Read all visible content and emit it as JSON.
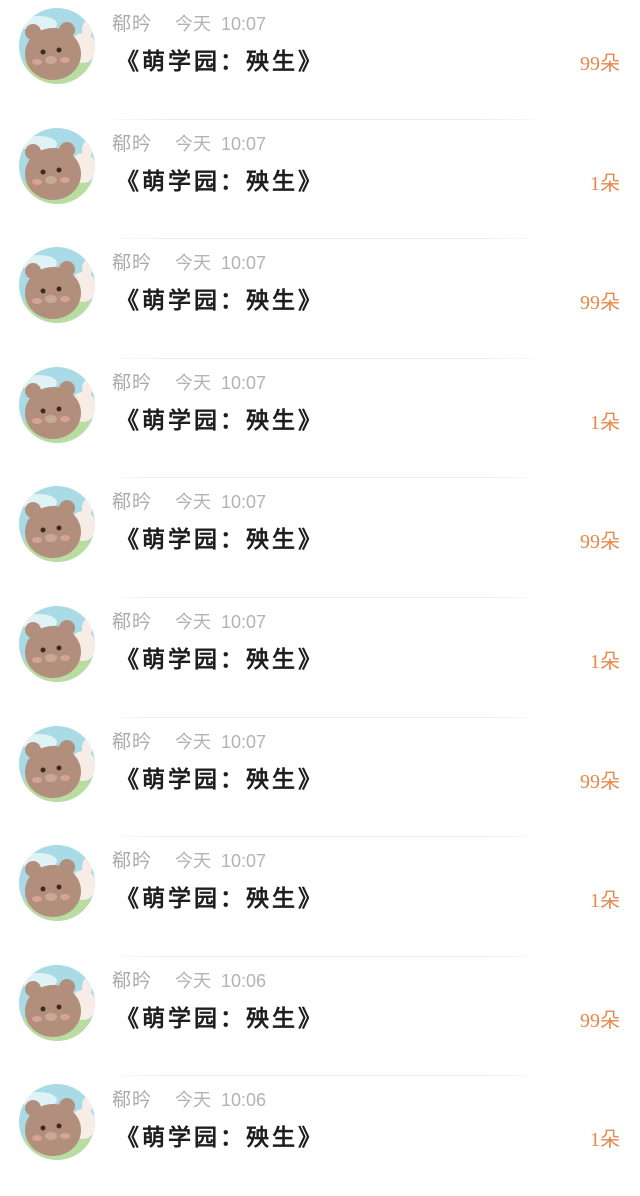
{
  "colors": {
    "sender_text": "#a9a9a9",
    "time_text": "#b3b3b3",
    "title_text": "#1e1e1e",
    "amount_text": "#e8884a",
    "avatar_bg_sky": "#a9dbe7",
    "avatar_bg_grass": "#b9dca1",
    "avatar_bear": "#b18f7c"
  },
  "messages": [
    {
      "sender": "郗昑",
      "day": "今天",
      "time": "10:07",
      "title": "《萌学园：殃生》",
      "amount": "99朵",
      "avatar": "bear-avatar-icon"
    },
    {
      "sender": "郗昑",
      "day": "今天",
      "time": "10:07",
      "title": "《萌学园：殃生》",
      "amount": "1朵",
      "avatar": "bear-avatar-icon"
    },
    {
      "sender": "郗昑",
      "day": "今天",
      "time": "10:07",
      "title": "《萌学园：殃生》",
      "amount": "99朵",
      "avatar": "bear-avatar-icon"
    },
    {
      "sender": "郗昑",
      "day": "今天",
      "time": "10:07",
      "title": "《萌学园：殃生》",
      "amount": "1朵",
      "avatar": "bear-avatar-icon"
    },
    {
      "sender": "郗昑",
      "day": "今天",
      "time": "10:07",
      "title": "《萌学园：殃生》",
      "amount": "99朵",
      "avatar": "bear-avatar-icon"
    },
    {
      "sender": "郗昑",
      "day": "今天",
      "time": "10:07",
      "title": "《萌学园：殃生》",
      "amount": "1朵",
      "avatar": "bear-avatar-icon"
    },
    {
      "sender": "郗昑",
      "day": "今天",
      "time": "10:07",
      "title": "《萌学园：殃生》",
      "amount": "99朵",
      "avatar": "bear-avatar-icon"
    },
    {
      "sender": "郗昑",
      "day": "今天",
      "time": "10:07",
      "title": "《萌学园：殃生》",
      "amount": "1朵",
      "avatar": "bear-avatar-icon"
    },
    {
      "sender": "郗昑",
      "day": "今天",
      "time": "10:06",
      "title": "《萌学园：殃生》",
      "amount": "99朵",
      "avatar": "bear-avatar-icon"
    },
    {
      "sender": "郗昑",
      "day": "今天",
      "time": "10:06",
      "title": "《萌学园：殃生》",
      "amount": "1朵",
      "avatar": "bear-avatar-icon"
    }
  ]
}
